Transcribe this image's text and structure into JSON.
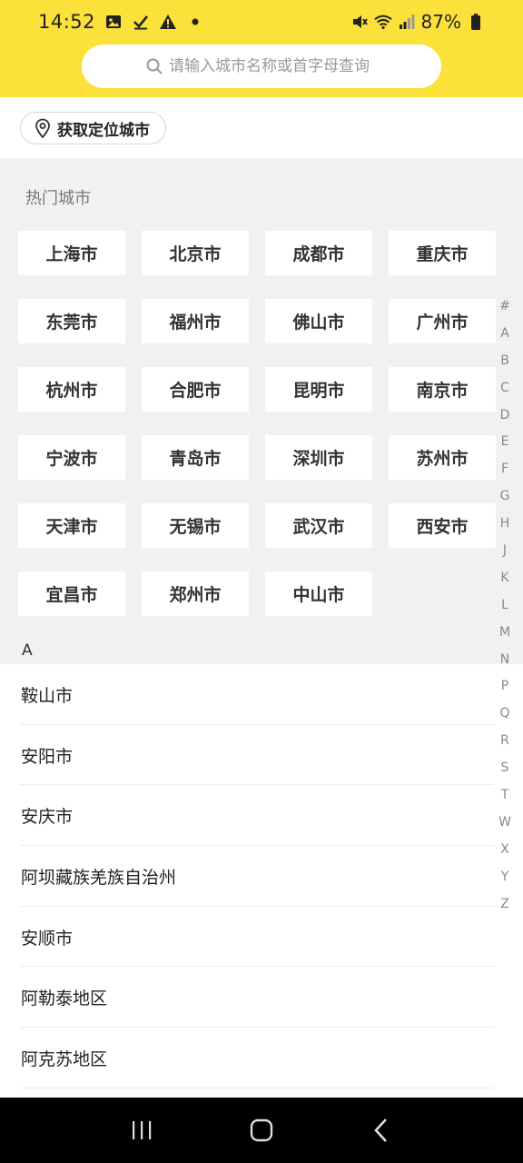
{
  "status_bar": {
    "time": "14:52",
    "battery": "87%",
    "left_icons": [
      "image-icon",
      "check-icon",
      "warning-icon",
      "dot-icon"
    ],
    "right_icons": [
      "mute-icon",
      "wifi-icon",
      "signal-icon",
      "battery-icon"
    ]
  },
  "search": {
    "placeholder": "请输入城市名称或首字母查询"
  },
  "location": {
    "button_label": "获取定位城市"
  },
  "hot_cities": {
    "title": "热门城市",
    "items": [
      "上海市",
      "北京市",
      "成都市",
      "重庆市",
      "东莞市",
      "福州市",
      "佛山市",
      "广州市",
      "杭州市",
      "合肥市",
      "昆明市",
      "南京市",
      "宁波市",
      "青岛市",
      "深圳市",
      "苏州市",
      "天津市",
      "无锡市",
      "武汉市",
      "西安市",
      "宜昌市",
      "郑州市",
      "中山市"
    ]
  },
  "section": {
    "letter": "A"
  },
  "city_list": {
    "items": [
      "鞍山市",
      "安阳市",
      "安庆市",
      "阿坝藏族羌族自治州",
      "安顺市",
      "阿勒泰地区",
      "阿克苏地区"
    ]
  },
  "index_bar": {
    "letters": [
      "#",
      "A",
      "B",
      "C",
      "D",
      "E",
      "F",
      "G",
      "H",
      "J",
      "K",
      "L",
      "M",
      "N",
      "P",
      "Q",
      "R",
      "S",
      "T",
      "W",
      "X",
      "Y",
      "Z"
    ]
  },
  "colors": {
    "header": "#FBE13A",
    "background": "#f1f1f1",
    "nav": "#000000"
  }
}
